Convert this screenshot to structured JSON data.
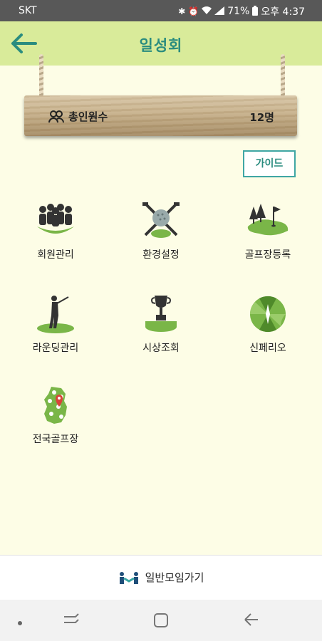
{
  "status_bar": {
    "carrier": "SKT",
    "battery": "71%",
    "time": "오후 4:37"
  },
  "app_bar": {
    "title": "일성회"
  },
  "board": {
    "members_label": "총인원수",
    "members_count": "12명"
  },
  "guide_button": {
    "label": "가이드"
  },
  "menu": [
    {
      "label": "회원관리",
      "icon": "members-icon"
    },
    {
      "label": "환경설정",
      "icon": "golf-ball-clubs-icon"
    },
    {
      "label": "골프장등록",
      "icon": "golf-course-flag-icon"
    },
    {
      "label": "라운딩관리",
      "icon": "golfer-icon"
    },
    {
      "label": "시상조회",
      "icon": "trophy-icon"
    },
    {
      "label": "신페리오",
      "icon": "peoria-wheel-icon"
    },
    {
      "label": "전국골프장",
      "icon": "korea-map-icon"
    }
  ],
  "bottom_link": {
    "label": "일반모임가기"
  },
  "colors": {
    "accent": "#2a8c7f",
    "app_bar": "#d9eb9a",
    "background": "#fdfde6",
    "icon_green": "#7ab648"
  }
}
